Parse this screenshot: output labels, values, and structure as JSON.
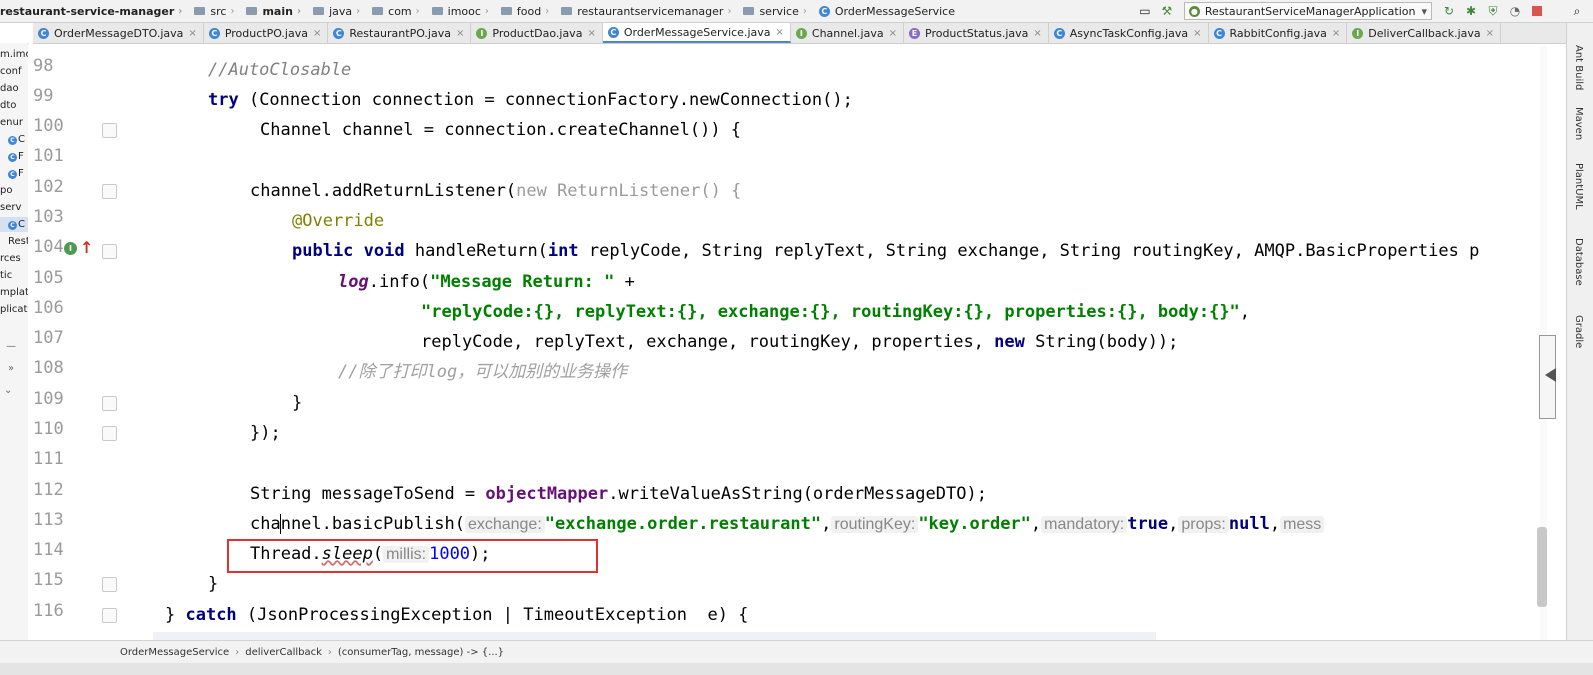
{
  "navbar": {
    "crumbs": [
      "restaurant-service-manager",
      "src",
      "main",
      "java",
      "com",
      "imooc",
      "food",
      "restaurantservicemanager",
      "service",
      "OrderMessageService"
    ],
    "run_config": "RestaurantServiceManagerApplication"
  },
  "tabs": [
    {
      "label": "OrderMessageDTO.java",
      "icon": "class-icon"
    },
    {
      "label": "ProductPO.java",
      "icon": "class-icon"
    },
    {
      "label": "RestaurantPO.java",
      "icon": "class-icon"
    },
    {
      "label": "ProductDao.java",
      "icon": "interface-icon"
    },
    {
      "label": "OrderMessageService.java",
      "icon": "class-icon"
    },
    {
      "label": "Channel.java",
      "icon": "interface-icon"
    },
    {
      "label": "ProductStatus.java",
      "icon": "enum-icon"
    },
    {
      "label": "AsyncTaskConfig.java",
      "icon": "class-icon"
    },
    {
      "label": "RabbitConfig.java",
      "icon": "class-icon"
    },
    {
      "label": "DeliverCallback.java",
      "icon": "interface-icon"
    }
  ],
  "tree": [
    "m.imo",
    "conf",
    "dao",
    "dto",
    "enur",
    "C",
    "F",
    "F",
    "po",
    "serv",
    "C",
    "Rest",
    "rces",
    "tic",
    "mplat",
    "plicat",
    "»"
  ],
  "right_panel": [
    "Ant Build",
    "Maven",
    "PlantUML",
    "Database",
    "Gradle"
  ],
  "code": {
    "lines": [
      "98",
      "99",
      "100",
      "101",
      "102",
      "103",
      "104",
      "105",
      "106",
      "107",
      "108",
      "109",
      "110",
      "111",
      "112",
      "113",
      "114",
      "115",
      "116"
    ],
    "l98_comment": "//AutoClosable",
    "l99_try": "try",
    "l99_rest": " (Connection connection = connectionFactory.newConnection();",
    "l100": "Channel channel = connection.createChannel()) {",
    "l102_a": "channel.addReturnListener(",
    "l102_new": "new",
    "l102_b": " ReturnListener() {",
    "l103": "@Override",
    "l104_public": "public",
    "l104_void": "void",
    "l104_a": " handleReturn(",
    "l104_int": "int",
    "l104_b": " replyCode, String replyText, String exchange, String routingKey, AMQP.BasicProperties p",
    "l105_log": "log",
    "l105_a": ".info(",
    "l105_str": "\"Message Return: \"",
    "l105_b": " +",
    "l106_str": "\"replyCode:{}, replyText:{}, exchange:{}, routingKey:{}, properties:{}, body:{}\"",
    "l106_b": ",",
    "l107_a": "replyCode, replyText, exchange, routingKey, properties, ",
    "l107_new": "new",
    "l107_b": " String(body));",
    "l108_comment": "//除了打印log，可以加别的业务操作",
    "l109": "}",
    "l110": "});",
    "l112_a": "String messageToSend = ",
    "l112_fld": "objectMapper",
    "l112_b": ".writeValueAsString(orderMessageDTO);",
    "l113_a": "channel.basicPublish(",
    "l113_hint1": "exchange:",
    "l113_str1": "\"exchange.order.restaurant\"",
    "l113_c1": ",",
    "l113_hint2": "routingKey:",
    "l113_str2": "\"key.order\"",
    "l113_c2": ",",
    "l113_hint3": "mandatory:",
    "l113_true": "true",
    "l113_c3": ",",
    "l113_hint4": "props:",
    "l113_null": "null",
    "l113_c4": ",",
    "l113_hint5": "mess",
    "l114_a": "Thread.",
    "l114_m": "sleep",
    "l114_b": "(",
    "l114_hint": "millis:",
    "l114_num": "1000",
    "l114_c": ");",
    "l115": "}",
    "l116_a": "} ",
    "l116_catch": "catch",
    "l116_b": " (JsonProcessingException | TimeoutException  e) {"
  },
  "statusbar": {
    "crumbs": [
      "OrderMessageService",
      "deliverCallback",
      "(consumerTag, message) -> {...}"
    ]
  },
  "colors": {
    "keyword": "#000080",
    "string": "#008000",
    "comment": "#808080",
    "annotation": "#808000",
    "field": "#660e7a",
    "number": "#0000ff",
    "highlight_box": "#e03030"
  }
}
